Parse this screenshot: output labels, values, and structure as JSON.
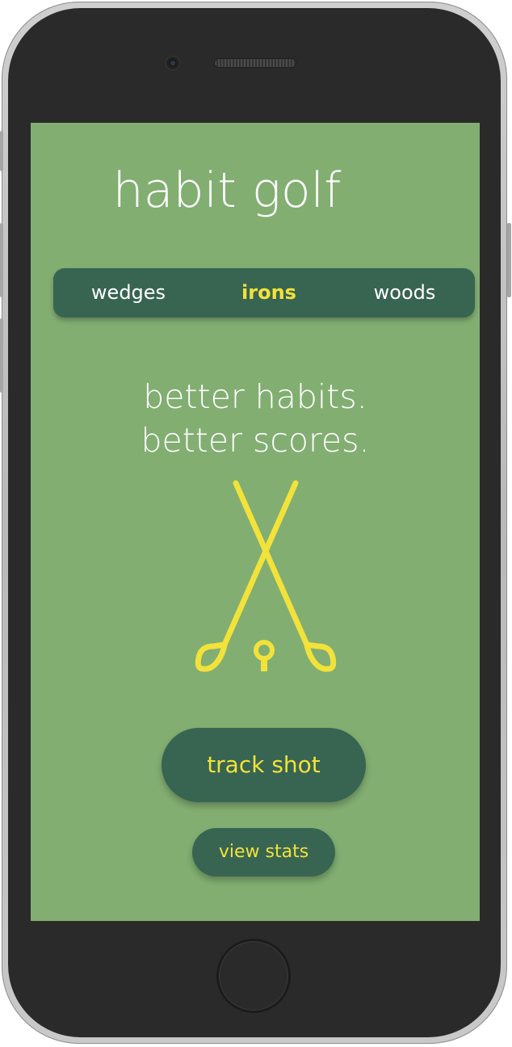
{
  "app": {
    "title": "habit golf"
  },
  "club_tabs": [
    {
      "label": "wedges",
      "active": false
    },
    {
      "label": "irons",
      "active": true
    },
    {
      "label": "woods",
      "active": false
    }
  ],
  "tagline": {
    "line1": "better habits.",
    "line2": "better scores."
  },
  "illustration": {
    "icon": "crossed-golf-clubs-icon",
    "color": "#f2e23a"
  },
  "actions": {
    "track_shot_label": "track shot",
    "view_stats_label": "view stats"
  },
  "colors": {
    "background": "#82ae72",
    "accent_dark": "#386452",
    "accent_yellow": "#f2e23a",
    "text": "#ffffff"
  }
}
